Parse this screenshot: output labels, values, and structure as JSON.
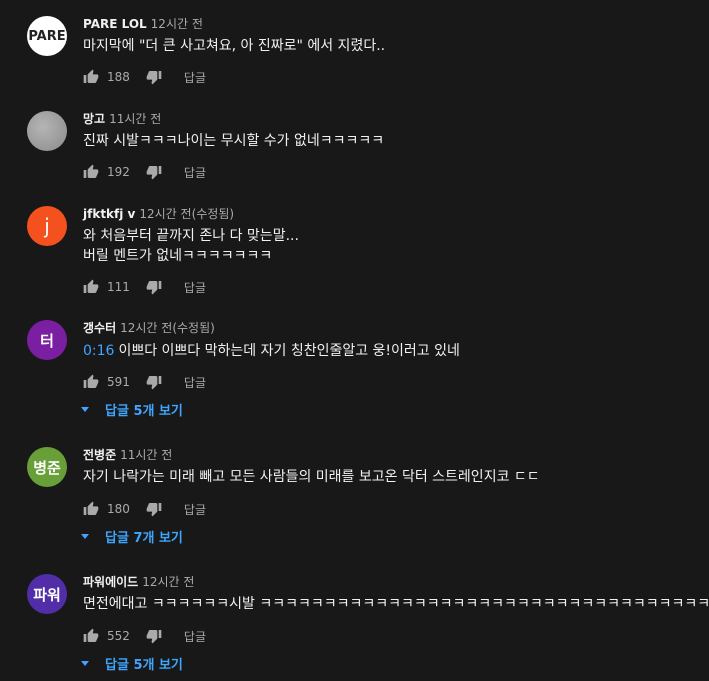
{
  "ui": {
    "reply_label": "답글"
  },
  "comments": [
    {
      "author": "PARE LOL",
      "time": "12시간 전",
      "avatar_text": "PARE",
      "avatar_color": "#ffffff",
      "line1_ts": "",
      "line1": "마지막에 \"더 큰 사고쳐요, 아 진짜로\" 에서 지렸다..",
      "line2": "",
      "likes": "188",
      "replies": ""
    },
    {
      "author": "망고",
      "time": "11시간 전",
      "avatar_text": "",
      "avatar_color": "#9a9a9a",
      "line1_ts": "",
      "line1": "진짜 시발ㅋㅋㅋ나이는 무시할 수가 없네ㅋㅋㅋㅋㅋ",
      "line2": "",
      "likes": "192",
      "replies": ""
    },
    {
      "author": "jfktkfj v",
      "time": "12시간 전(수정됨)",
      "avatar_text": "j",
      "avatar_color": "#f4511e",
      "line1_ts": "",
      "line1": "와 처음부터 끝까지 존나 다 맞는말...",
      "line2": "버릴 멘트가 없네ㅋㅋㅋㅋㅋㅋㅋ",
      "likes": "111",
      "replies": ""
    },
    {
      "author": "갱수터",
      "time": "12시간 전(수정됨)",
      "avatar_text": "터",
      "avatar_color": "#7b1fa2",
      "line1_ts": "0:16",
      "line1": "이쁘다 이쁘다 막하는데 자기 칭찬인줄알고 웅!이러고 있네",
      "line2": "",
      "likes": "591",
      "replies": "답글 5개 보기"
    },
    {
      "author": "전병준",
      "time": "11시간 전",
      "avatar_text": "병준",
      "avatar_color": "#689f38",
      "line1_ts": "",
      "line1": "자기 나락가는 미래 빼고 모든 사람들의 미래를 보고온 닥터 스트레인지코 ㄷㄷ",
      "line2": "",
      "likes": "180",
      "replies": "답글 7개 보기"
    },
    {
      "author": "파워에이드",
      "time": "12시간 전",
      "avatar_text": "파워",
      "avatar_color": "#512da8",
      "line1_ts": "",
      "line1": "면전에대고 ㅋㅋㅋㅋㅋㅋ시발 ㅋㅋㅋㅋㅋㅋㅋㅋㅋㅋㅋㅋㅋㅋㅋㅋㅋㅋㅋㅋㅋㅋㅋㅋㅋㅋㅋㅋㅋㅋㅋㅋㅋㅋㅋㅋㅋㅋㅋㅋ",
      "line2": "",
      "likes": "552",
      "replies": "답글 5개 보기"
    }
  ]
}
